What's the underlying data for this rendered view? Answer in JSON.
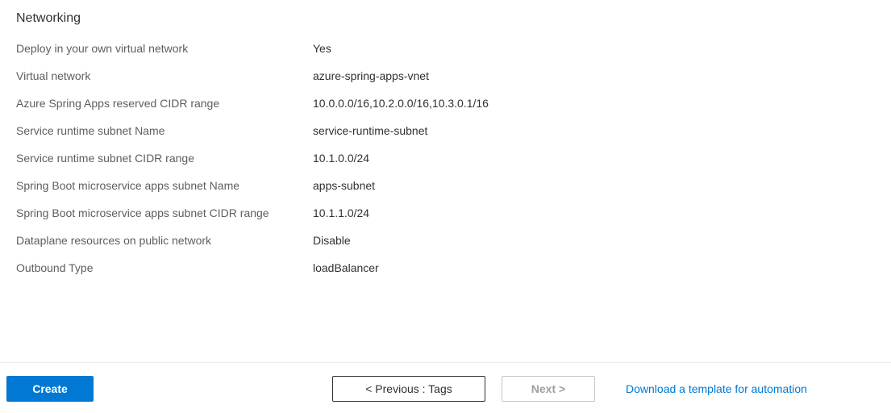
{
  "section": {
    "title": "Networking",
    "rows": [
      {
        "label": "Deploy in your own virtual network",
        "value": "Yes"
      },
      {
        "label": "Virtual network",
        "value": "azure-spring-apps-vnet"
      },
      {
        "label": "Azure Spring Apps reserved CIDR range",
        "value": "10.0.0.0/16,10.2.0.0/16,10.3.0.1/16"
      },
      {
        "label": "Service runtime subnet Name",
        "value": "service-runtime-subnet"
      },
      {
        "label": "Service runtime subnet CIDR range",
        "value": "10.1.0.0/24"
      },
      {
        "label": "Spring Boot microservice apps subnet Name",
        "value": "apps-subnet"
      },
      {
        "label": "Spring Boot microservice apps subnet CIDR range",
        "value": "10.1.1.0/24"
      },
      {
        "label": "Dataplane resources on public network",
        "value": "Disable"
      },
      {
        "label": "Outbound Type",
        "value": "loadBalancer"
      }
    ]
  },
  "footer": {
    "create": "Create",
    "previous": "< Previous : Tags",
    "next": "Next >",
    "download": "Download a template for automation"
  }
}
